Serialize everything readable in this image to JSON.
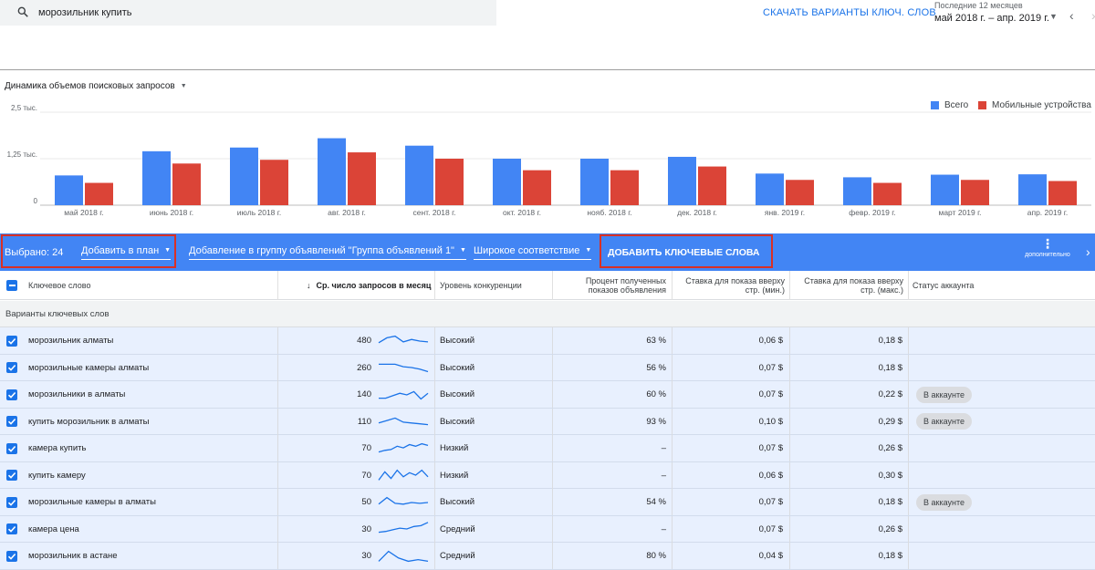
{
  "search": {
    "value": "морозильник купить"
  },
  "header": {
    "download_label": "СКАЧАТЬ ВАРИАНТЫ КЛЮЧ. СЛОВ",
    "period_label": "Последние 12 месяцев",
    "period_value": "май 2018 г. – апр. 2019 г."
  },
  "chart": {
    "title": "Динамика объемов поисковых запросов",
    "legend": [
      "Всего",
      "Мобильные устройства"
    ]
  },
  "chart_data": {
    "type": "bar",
    "categories": [
      "май 2018 г.",
      "июнь 2018 г.",
      "июль 2018 г.",
      "авг. 2018 г.",
      "сент. 2018 г.",
      "окт. 2018 г.",
      "нояб. 2018 г.",
      "дек. 2018 г.",
      "янв. 2019 г.",
      "февр. 2019 г.",
      "март 2019 г.",
      "апр. 2019 г."
    ],
    "series": [
      {
        "name": "Всего",
        "color": "#4285f4",
        "values": [
          800,
          1450,
          1550,
          1800,
          1600,
          1250,
          1250,
          1300,
          850,
          750,
          820,
          830
        ]
      },
      {
        "name": "Мобильные устройства",
        "color": "#db4437",
        "values": [
          600,
          1120,
          1220,
          1420,
          1250,
          940,
          940,
          1040,
          680,
          600,
          680,
          650
        ]
      }
    ],
    "ytick_labels": [
      "2,5 тыс.",
      "1,25 тыс.",
      "0"
    ],
    "yticks": [
      2500,
      1250,
      0
    ],
    "ylim": [
      0,
      2500
    ],
    "grid": true,
    "legend_position": "top-right"
  },
  "toolbar": {
    "selected": "Выбрано: 24",
    "add_to_plan": "Добавить в план",
    "add_to_group": "Добавление в группу объявлений \"Группа объявлений 1\"",
    "match_type": "Широкое соответствие",
    "add_keywords": "ДОБАВИТЬ КЛЮЧЕВЫЕ СЛОВА",
    "more": "дополнительно"
  },
  "table": {
    "headers": {
      "keyword": "Ключевое слово",
      "avg_searches": "Ср. число запросов в месяц",
      "competition": "Уровень конкуренции",
      "impr_share_1": "Процент полученных",
      "impr_share_2": "показов объявления",
      "bid_low_1": "Ставка для показа вверху",
      "bid_low_2": "стр. (мин.)",
      "bid_high_1": "Ставка для показа вверху",
      "bid_high_2": "стр. (макс.)",
      "status": "Статус аккаунта"
    },
    "group_label": "Варианты ключевых слов",
    "rows": [
      {
        "keyword": "морозильник алматы",
        "searches": "480",
        "competition": "Высокий",
        "impr": "63 %",
        "bid_low": "0,06 $",
        "bid_high": "0,18 $",
        "status": "",
        "trend": [
          0.6,
          0.3,
          0.2,
          0.55,
          0.4,
          0.5,
          0.55
        ]
      },
      {
        "keyword": "морозильные камеры алматы",
        "searches": "260",
        "competition": "Высокий",
        "impr": "56 %",
        "bid_low": "0,07 $",
        "bid_high": "0,18 $",
        "status": "",
        "trend": [
          0.3,
          0.3,
          0.3,
          0.45,
          0.5,
          0.6,
          0.75
        ]
      },
      {
        "keyword": "морозильники в алматы",
        "searches": "140",
        "competition": "Высокий",
        "impr": "60 %",
        "bid_low": "0,07 $",
        "bid_high": "0,22 $",
        "status": "В аккаунте",
        "trend": [
          0.7,
          0.7,
          0.55,
          0.4,
          0.5,
          0.3,
          0.75,
          0.4
        ]
      },
      {
        "keyword": "купить морозильник в алматы",
        "searches": "110",
        "competition": "Высокий",
        "impr": "93 %",
        "bid_low": "0,10 $",
        "bid_high": "0,29 $",
        "status": "В аккаунте",
        "trend": [
          0.6,
          0.45,
          0.3,
          0.55,
          0.6,
          0.65,
          0.7
        ]
      },
      {
        "keyword": "камера купить",
        "searches": "70",
        "competition": "Низкий",
        "impr": "–",
        "bid_low": "0,07 $",
        "bid_high": "0,26 $",
        "status": "",
        "trend": [
          0.7,
          0.6,
          0.55,
          0.35,
          0.45,
          0.25,
          0.35,
          0.2,
          0.3
        ]
      },
      {
        "keyword": "купить камеру",
        "searches": "70",
        "competition": "Низкий",
        "impr": "–",
        "bid_low": "0,06 $",
        "bid_high": "0,30 $",
        "status": "",
        "trend": [
          0.8,
          0.3,
          0.7,
          0.2,
          0.6,
          0.35,
          0.5,
          0.2,
          0.6
        ]
      },
      {
        "keyword": "морозильные камеры в алматы",
        "searches": "50",
        "competition": "Высокий",
        "impr": "54 %",
        "bid_low": "0,07 $",
        "bid_high": "0,18 $",
        "status": "В аккаунте",
        "trend": [
          0.6,
          0.2,
          0.55,
          0.6,
          0.5,
          0.55,
          0.5
        ]
      },
      {
        "keyword": "камера цена",
        "searches": "30",
        "competition": "Средний",
        "impr": "–",
        "bid_low": "0,07 $",
        "bid_high": "0,26 $",
        "status": "",
        "trend": [
          0.7,
          0.65,
          0.55,
          0.45,
          0.5,
          0.35,
          0.3,
          0.1
        ]
      },
      {
        "keyword": "морозильник в астане",
        "searches": "30",
        "competition": "Средний",
        "impr": "80 %",
        "bid_low": "0,04 $",
        "bid_high": "0,18 $",
        "status": "",
        "trend": [
          0.8,
          0.2,
          0.6,
          0.8,
          0.7,
          0.8
        ]
      }
    ]
  }
}
